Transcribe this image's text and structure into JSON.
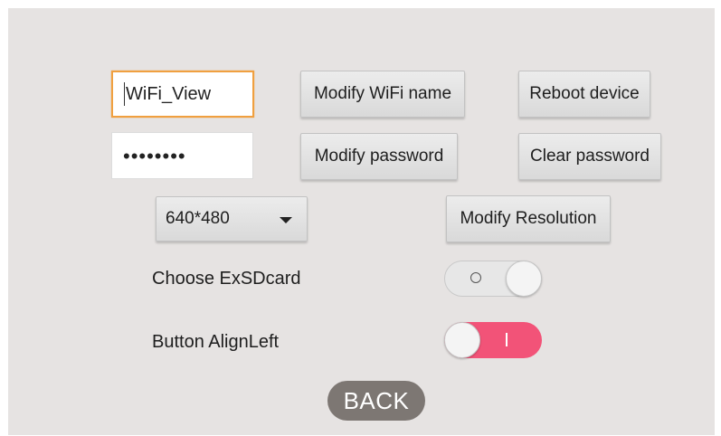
{
  "wifi_name": {
    "value": "WiFi_View"
  },
  "password": {
    "value": "••••••••"
  },
  "buttons": {
    "modify_wifi_name": "Modify WiFi name",
    "reboot_device": "Reboot device",
    "modify_password": "Modify password",
    "clear_password": "Clear password",
    "modify_resolution": "Modify Resolution",
    "back": "BACK"
  },
  "resolution": {
    "selected": "640*480"
  },
  "options": [
    {
      "label": "Choose ExSDcard",
      "state": "off",
      "glyph": "O"
    },
    {
      "label": "Button AlignLeft",
      "state": "on",
      "glyph": "I"
    }
  ],
  "colors": {
    "background": "#e6e3e2",
    "focus_border": "#f0a040",
    "toggle_on": "#f25378",
    "back_button": "#7d7773"
  }
}
